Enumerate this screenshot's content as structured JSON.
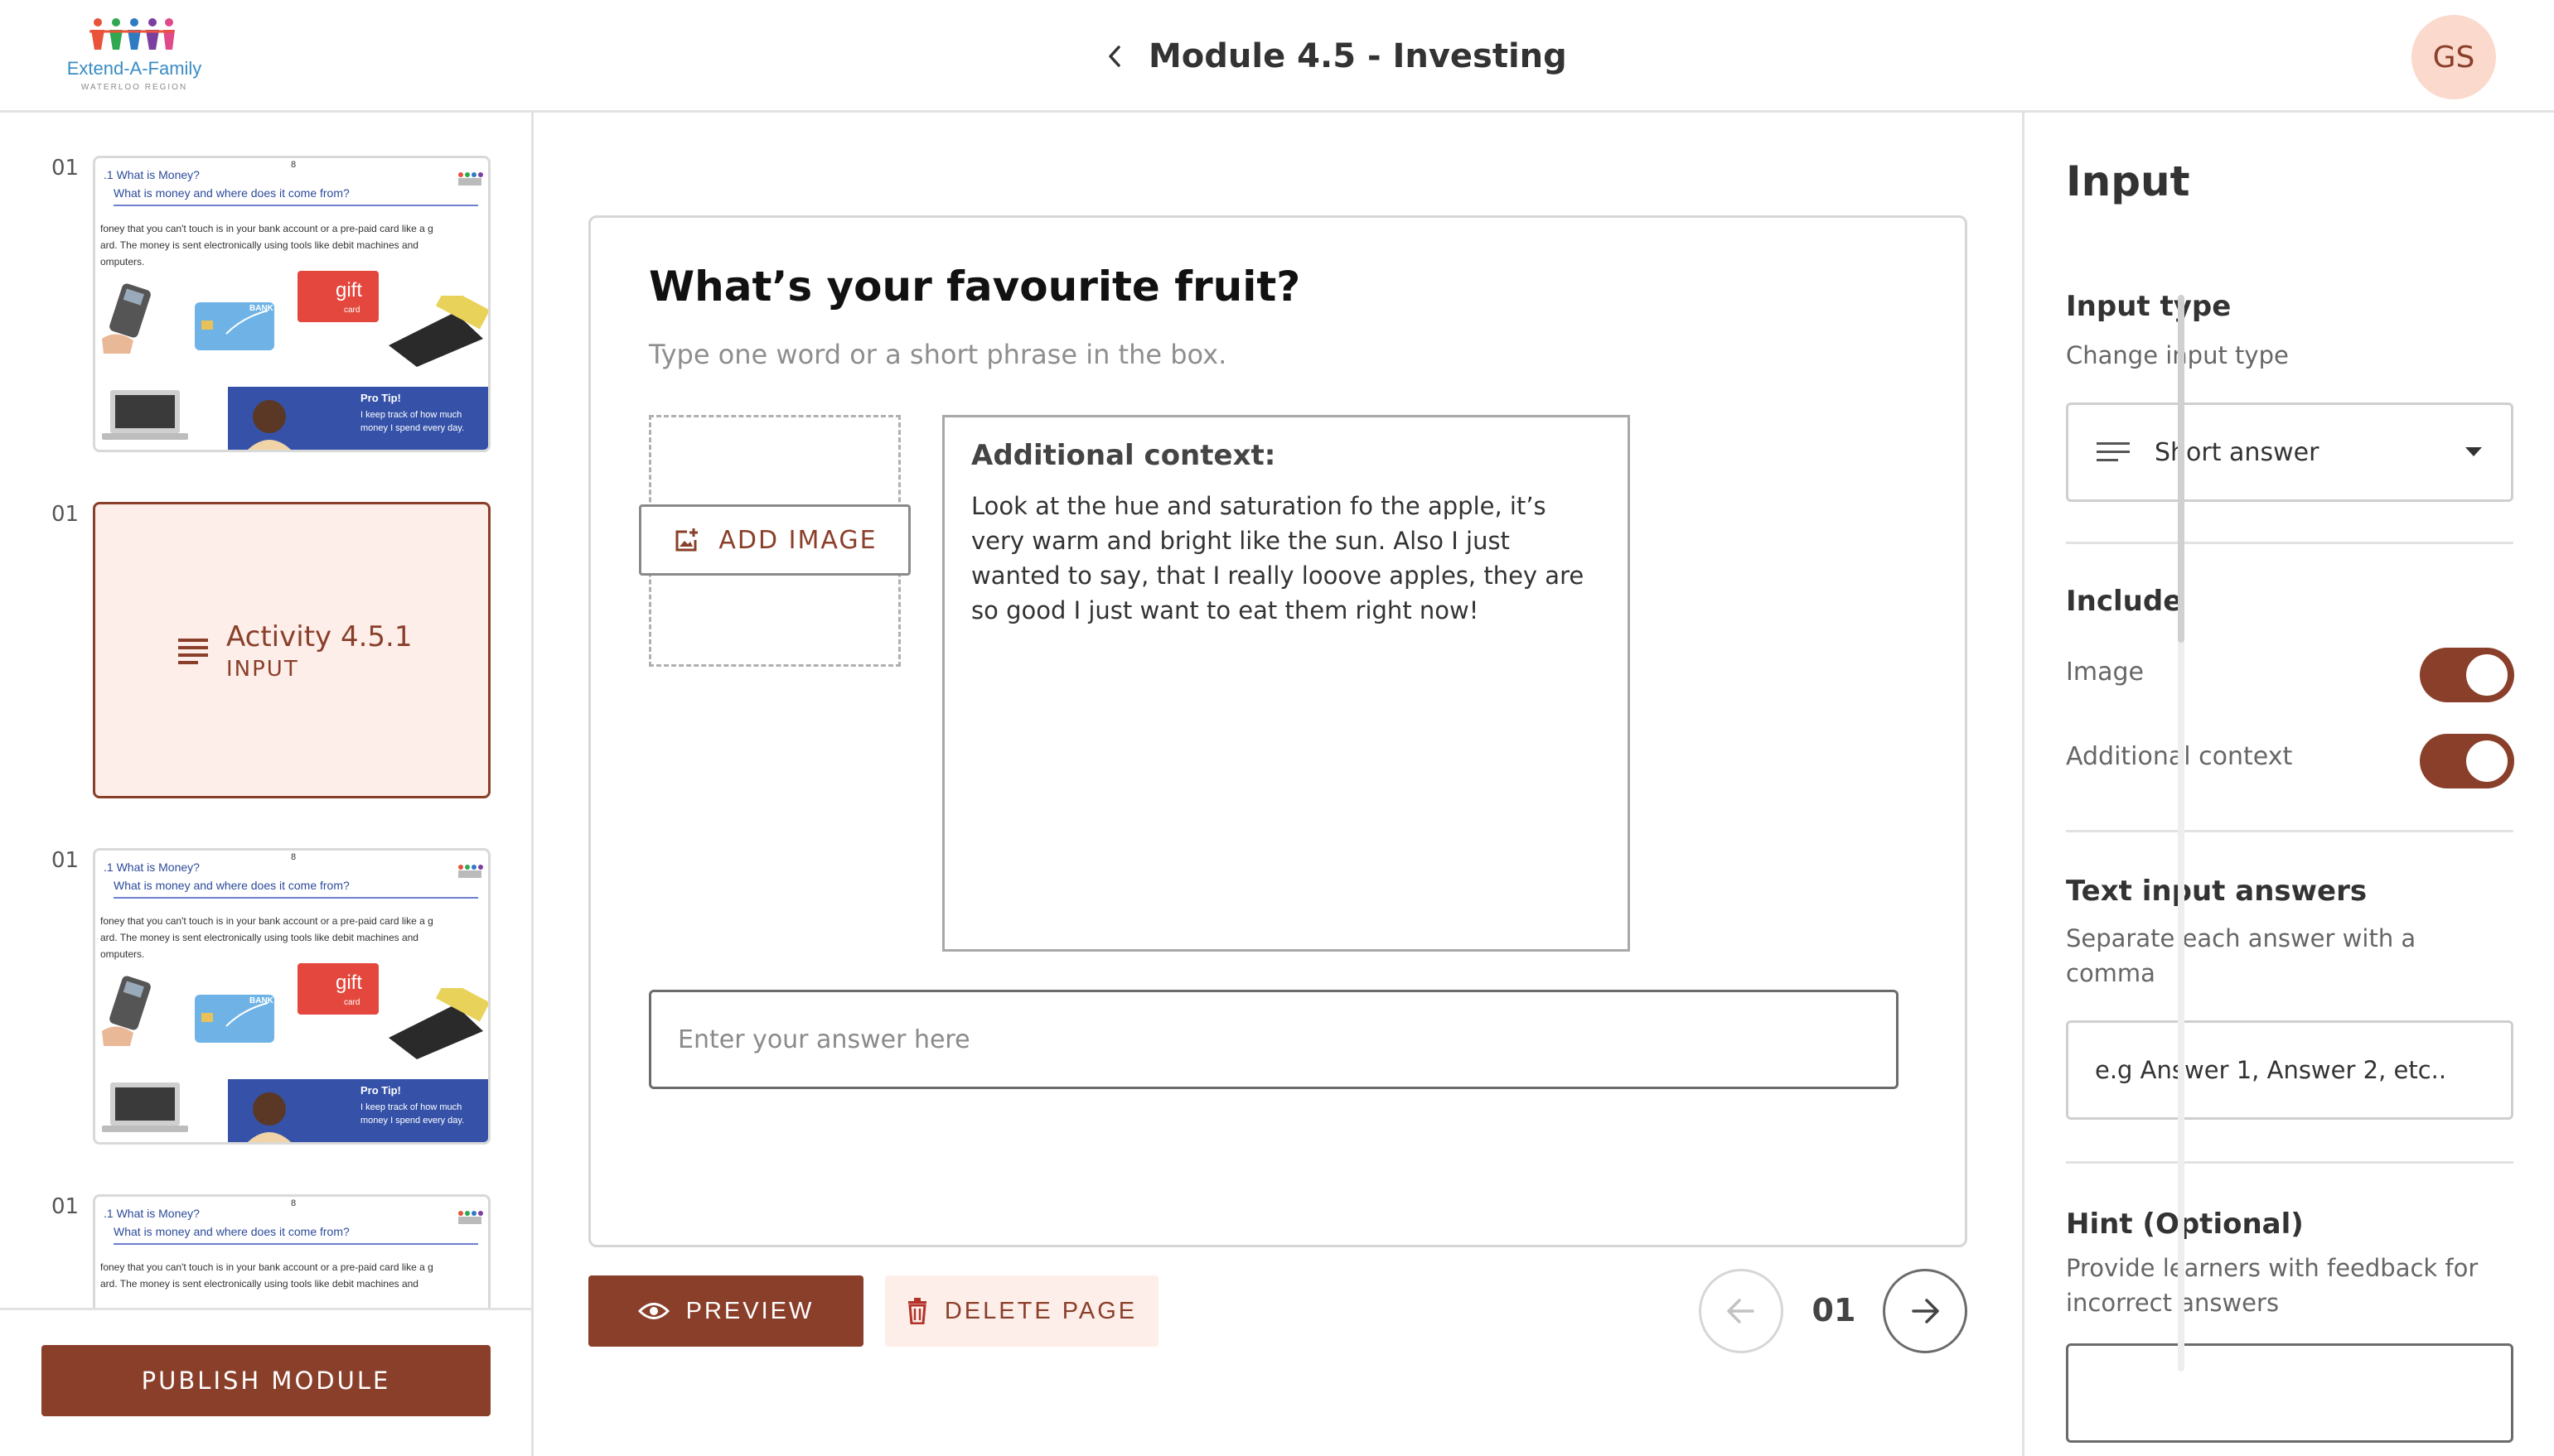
{
  "header": {
    "logo_text": "Extend-A-Family",
    "logo_subtext": "WATERLOO REGION",
    "module_title": "Module 4.5 - Investing",
    "back_icon": "chevron-left-icon",
    "avatar_initials": "GS"
  },
  "sidebar": {
    "slides": [
      {
        "number": "01",
        "kind": "image",
        "heading": ".1 What is Money?",
        "page": "8",
        "subheading": "What is money and where does it come from?",
        "body": [
          "foney that you can't touch is in your bank account or a pre-paid card like a g",
          "ard.  The money is sent electronically using tools like debit machines and",
          "omputers."
        ],
        "gift_label": "gift",
        "gift_sub": "card",
        "bank_label": "BANK",
        "protip_title": "Pro Tip!",
        "protip_text": "I keep track of how much money I spend every day."
      },
      {
        "number": "01",
        "kind": "activity",
        "title": "Activity 4.5.1",
        "type": "INPUT",
        "icon": "lines-icon"
      },
      {
        "number": "01",
        "kind": "image",
        "heading": ".1 What is Money?",
        "page": "8",
        "subheading": "What is money and where does it come from?",
        "body": [
          "foney that you can't touch is in your bank account or a pre-paid card like a g",
          "ard.  The money is sent electronically using tools like debit machines and",
          "omputers."
        ],
        "gift_label": "gift",
        "gift_sub": "card",
        "bank_label": "BANK",
        "protip_title": "Pro Tip!",
        "protip_text": "I keep track of how much money I spend every day."
      },
      {
        "number": "01",
        "kind": "image",
        "heading": ".1 What is Money?",
        "page": "8",
        "subheading": "What is money and where does it come from?",
        "body": [
          "foney that you can't touch is in your bank account or a pre-paid card like a g",
          "ard.  The money is sent electronically using tools like debit machines and"
        ]
      }
    ],
    "publish_label": "PUBLISH MODULE"
  },
  "editor": {
    "question": "What’s your favourite fruit?",
    "instruction": "Type one word or a short phrase in the box.",
    "add_image_label": "ADD IMAGE",
    "context_title": "Additional context:",
    "context_text": "Look at the hue and saturation fo the apple, it’s very warm and bright like the sun. Also I just wanted to say, that I really looove apples, they are so good I just want to eat them right now!",
    "answer_placeholder": "Enter your answer here",
    "preview_label": "PREVIEW",
    "delete_label": "DELETE PAGE",
    "page_number": "01"
  },
  "panel": {
    "title": "Input",
    "input_type_heading": "Input type",
    "input_type_sub": "Change input type",
    "input_type_value": "Short answer",
    "include_heading": "Include",
    "include_image_label": "Image",
    "include_image_on": true,
    "include_context_label": "Additional context",
    "include_context_on": true,
    "answers_heading": "Text input answers",
    "answers_sub": "Separate each answer with a comma",
    "answers_placeholder": "e.g Answer 1, Answer 2, etc..",
    "hint_heading": "Hint (Optional)",
    "hint_sub": "Provide learners with feedback for incorrect answers"
  },
  "colors": {
    "accent": "#8a3f2a",
    "accent_light": "#fdeee9",
    "avatar_bg": "#fbd9cd",
    "border": "#e2e2e2"
  }
}
